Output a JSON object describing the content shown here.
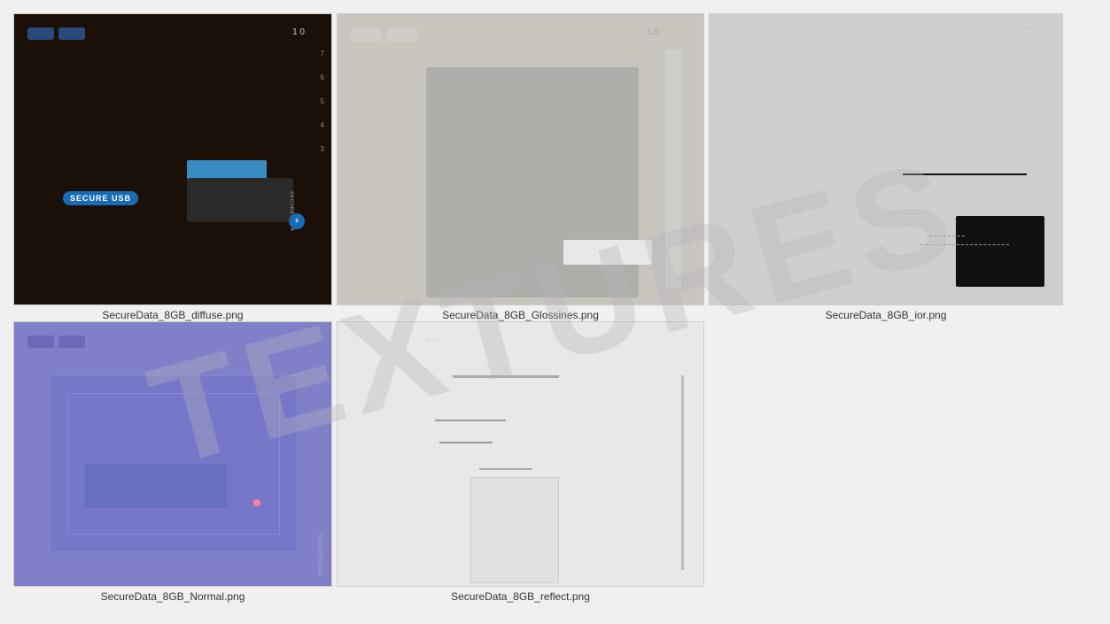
{
  "watermark": {
    "text": "TEXTURES"
  },
  "images": [
    {
      "id": "img1",
      "filename": "SecureData_8GB_diffuse.png",
      "type": "diffuse",
      "secure_usb_label": "SECURE USB",
      "counter": "1  0",
      "top_buttons": [
        "btn1",
        "btn2"
      ],
      "scale_marks": [
        "7",
        "6",
        "5",
        "4",
        "3"
      ]
    },
    {
      "id": "img2",
      "filename": "SecureData_8GB_Glossines.png",
      "type": "glossiness"
    },
    {
      "id": "img3",
      "filename": "SecureData_8GB_ior.png",
      "type": "ior"
    },
    {
      "id": "img4",
      "filename": "SecureData_8GB_Normal.png",
      "type": "normal"
    },
    {
      "id": "img5",
      "filename": "SecureData_8GB_reflect.png",
      "type": "reflect"
    }
  ]
}
